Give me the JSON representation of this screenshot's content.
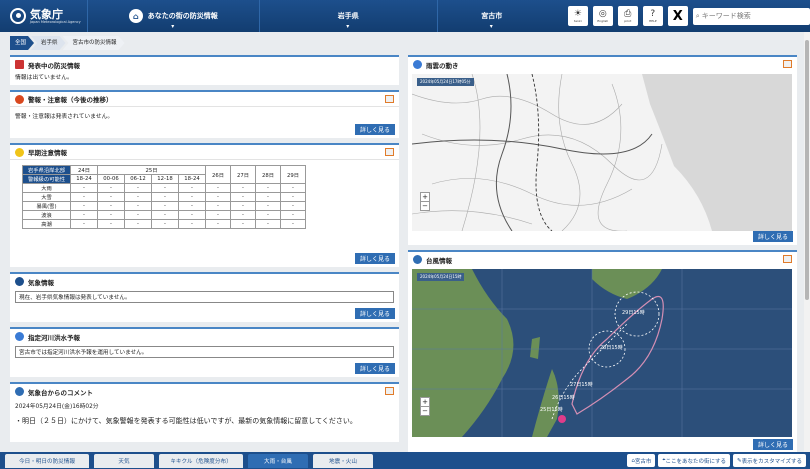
{
  "header": {
    "logo_text": "気象庁",
    "logo_sub": "Japan Meteorological Agency",
    "nav": [
      {
        "label": "あなたの街の防災情報",
        "icon": "house-icon"
      },
      {
        "label": "岩手県"
      },
      {
        "label": "宮古市"
      }
    ],
    "icons": [
      {
        "name": "tenki-icon",
        "sub": "tenki"
      },
      {
        "name": "english-icon",
        "sub": "English"
      },
      {
        "name": "print-icon",
        "sub": "print"
      },
      {
        "name": "help-icon",
        "sub": "HELP"
      }
    ],
    "x_label": "X",
    "search_placeholder": "キーワード検索"
  },
  "breadcrumb": [
    "全国",
    "岩手県",
    "宮古市の防災情報"
  ],
  "panels": {
    "alerts": {
      "title": "発表中の防災情報",
      "body": "情報は出ていません。"
    },
    "warnings": {
      "title": "警報・注意報（今後の推移）",
      "body": "警報・注意報は発表されていません。",
      "more": "詳しく見る"
    },
    "early": {
      "title": "早期注意情報",
      "more": "詳しく見る",
      "table": {
        "region": "岩手県沿岸北部",
        "level_label": "警報級の可能性",
        "day24": "24日",
        "day25": "25日",
        "later_days": [
          "26日",
          "27日",
          "28日",
          "29日"
        ],
        "times": [
          "18-24",
          "00-06",
          "06-12",
          "12-18",
          "18-24"
        ],
        "rows": [
          {
            "label": "大雨",
            "v": [
              "-",
              "-",
              "-",
              "-",
              "-",
              "-",
              "-",
              "-",
              "-"
            ]
          },
          {
            "label": "大雪",
            "v": [
              "-",
              "-",
              "-",
              "-",
              "-",
              "-",
              "-",
              "-",
              "-"
            ]
          },
          {
            "label": "暴風(雪)",
            "v": [
              "-",
              "-",
              "-",
              "-",
              "-",
              "-",
              "-",
              "-",
              "-"
            ]
          },
          {
            "label": "波浪",
            "v": [
              "-",
              "-",
              "-",
              "-",
              "-",
              "-",
              "-",
              "-",
              "-"
            ]
          },
          {
            "label": "高潮",
            "v": [
              "-",
              "-",
              "-",
              "-",
              "-",
              "-",
              "-",
              "-",
              "-"
            ]
          }
        ]
      }
    },
    "weather_info": {
      "title": "気象情報",
      "body": "現在、岩手県気象情報は発表していません。",
      "more": "詳しく見る"
    },
    "flood": {
      "title": "指定河川洪水予報",
      "body": "宮古市では指定河川洪水予報を運用していません。",
      "more": "詳しく見る"
    },
    "comment": {
      "title": "気象台からのコメント",
      "date": "2024年05月24日(金)16時02分",
      "body": "・明日（２５日）にかけて、気象警報を発表する可能性は低いですが、最新の気象情報に留意してください。"
    },
    "rain": {
      "title": "雨雲の動き",
      "stamp": "2024年05月24日17時05分",
      "more": "詳しく見る",
      "zoom_in": "+",
      "zoom_out": "−"
    },
    "typhoon": {
      "title": "台風情報",
      "stamp": "2024年05月24日15時",
      "more": "詳しく見る",
      "zoom_in": "+",
      "zoom_out": "−",
      "labels": [
        "29日15時",
        "28日15時",
        "27日15時",
        "26日15時",
        "25日15時"
      ]
    }
  },
  "footer": {
    "tabs": [
      {
        "label": "今日・明日の防災情報",
        "active": false
      },
      {
        "label": "天気",
        "active": false
      },
      {
        "label": "キキクル（危険度分布）",
        "active": false
      },
      {
        "label": "大雨・台風",
        "active": true
      },
      {
        "label": "地震・火山",
        "active": false
      }
    ],
    "buttons": [
      "宮古市",
      "ここをあなたの街にする",
      "表示をカスタマイズする"
    ]
  },
  "colors": {
    "brand": "#1d4f8c",
    "accent": "#2f6db3",
    "panel_border": "#4a86c5",
    "land": "#6b8f57",
    "track": "#d48fb4"
  }
}
